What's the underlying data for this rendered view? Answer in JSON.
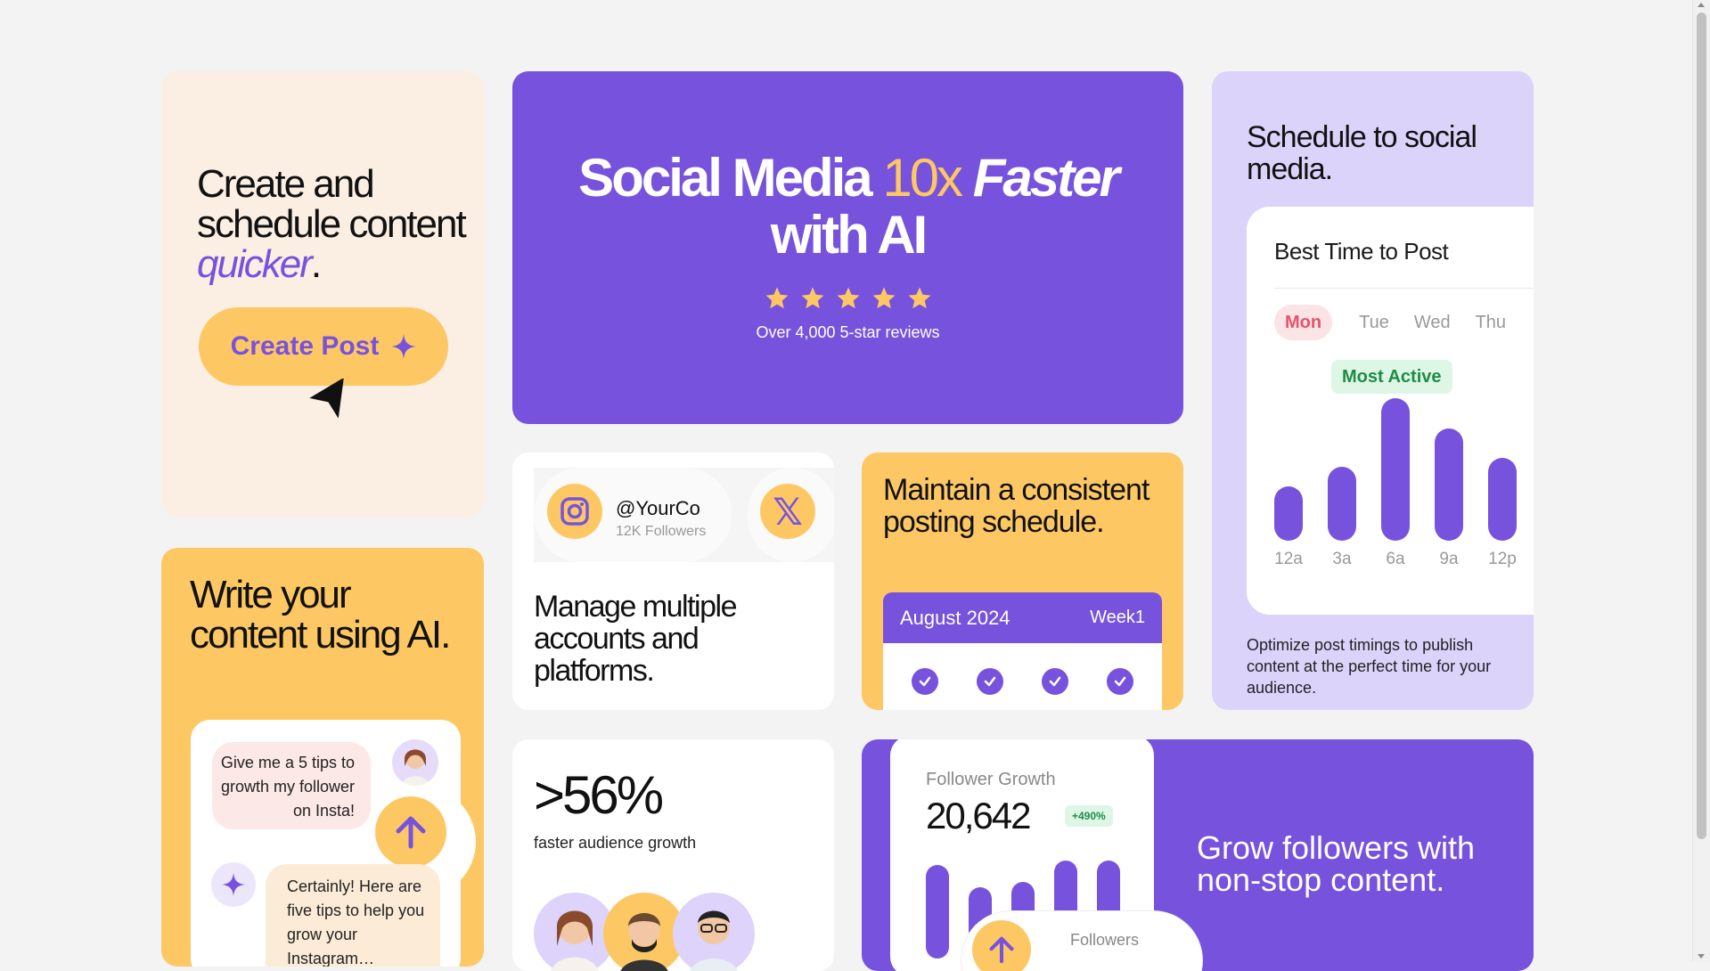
{
  "colors": {
    "purple": "#7752dd",
    "yellow": "#fdc864",
    "cream": "#fbeee2",
    "lavender": "#dcd3fb",
    "background": "#f3f3f3"
  },
  "create_card": {
    "title_before": "Create and schedule content ",
    "title_emph": "quicker",
    "title_after": ".",
    "button_label": "Create Post",
    "button_icon": "sparkle-icon",
    "cursor_icon": "cursor-arrow-icon"
  },
  "hero": {
    "line1_a": "Social Media ",
    "line1_highlight": "10x",
    "line1_emph": "Faster",
    "line2": "with AI",
    "rating_stars": 5,
    "reviews_text": "Over 4,000 5-star reviews"
  },
  "write_card": {
    "title": "Write your content using AI.",
    "user_message": "Give me a 5 tips to growth my follower on Insta!",
    "ai_message": "Certainly! Here are five tips to help you grow your Instagram…"
  },
  "accounts_card": {
    "handle": "@YourCo",
    "followers": "12K Followers",
    "platform_icons": [
      "instagram-icon",
      "x-icon"
    ],
    "x_glyph": "𝕏",
    "title": "Manage multiple accounts and platforms."
  },
  "posting_card": {
    "title": "Maintain a consistent posting schedule.",
    "calendar_month": "August 2024",
    "calendar_week": "Week1",
    "checked_days": 4
  },
  "schedule_card": {
    "title": "Schedule to social media.",
    "panel_title": "Best Time to Post",
    "days": [
      "Mon",
      "Tue",
      "Wed",
      "Thu"
    ],
    "active_day": "Mon",
    "badge": "Most Active",
    "description": "Optimize post timings to publish content at the perfect time for your audience."
  },
  "best_time_chart": {
    "type": "bar",
    "categories": [
      "12a",
      "3a",
      "6a",
      "9a",
      "12p"
    ],
    "values": [
      0.38,
      0.52,
      1.0,
      0.79,
      0.58
    ],
    "highlight": "6a"
  },
  "growth_card": {
    "stat": ">56%",
    "label": "faster audience growth"
  },
  "follower_card": {
    "label": "Follower Growth",
    "value": "20,642",
    "badge": "+490%",
    "popup_label": "Followers",
    "headline": "Grow followers with non-stop content."
  },
  "follower_chart": {
    "type": "bar",
    "values": [
      0.55,
      0.42,
      0.45,
      0.58,
      0.58
    ]
  }
}
